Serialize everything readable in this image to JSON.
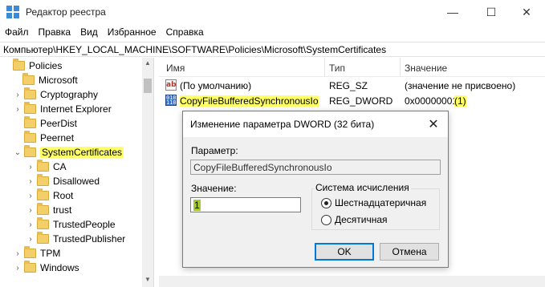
{
  "window": {
    "title": "Редактор реестра",
    "controls": {
      "minimize": "—",
      "maximize": "☐",
      "close": "✕"
    }
  },
  "menu": [
    "Файл",
    "Правка",
    "Вид",
    "Избранное",
    "Справка"
  ],
  "address": "Компьютер\\HKEY_LOCAL_MACHINE\\SOFTWARE\\Policies\\Microsoft\\SystemCertificates",
  "tree": {
    "items": [
      {
        "label": "Policies",
        "toggle": ""
      },
      {
        "label": "Microsoft",
        "toggle": ""
      },
      {
        "label": "Cryptography",
        "toggle": "›"
      },
      {
        "label": "Internet Explorer",
        "toggle": "›"
      },
      {
        "label": "PeerDist",
        "toggle": ""
      },
      {
        "label": "Peernet",
        "toggle": ""
      },
      {
        "label": "SystemCertificates",
        "toggle": "⌄",
        "selected": true
      },
      {
        "label": "CA",
        "toggle": "›"
      },
      {
        "label": "Disallowed",
        "toggle": "›"
      },
      {
        "label": "Root",
        "toggle": "›"
      },
      {
        "label": "trust",
        "toggle": "›"
      },
      {
        "label": "TrustedPeople",
        "toggle": "›"
      },
      {
        "label": "TrustedPublisher",
        "toggle": "›"
      },
      {
        "label": "TPM",
        "toggle": "›"
      },
      {
        "label": "Windows",
        "toggle": "›"
      }
    ]
  },
  "list": {
    "columns": [
      "Имя",
      "Тип",
      "Значение"
    ],
    "rows": [
      {
        "icon": "string-value-icon",
        "name": "(По умолчанию)",
        "type": "REG_SZ",
        "value": "(значение не присвоено)",
        "value_suffix": ""
      },
      {
        "icon": "binary-value-icon",
        "name": "CopyFileBufferedSynchronousIo",
        "type": "REG_DWORD",
        "value": "0x00000001",
        "value_suffix": "(1)"
      }
    ]
  },
  "dialog": {
    "title": "Изменение параметра DWORD (32 бита)",
    "close": "✕",
    "param_label": "Параметр:",
    "param_value": "CopyFileBufferedSynchronousIo",
    "value_label": "Значение:",
    "value": "1",
    "base_group": "Система исчисления",
    "radio_hex": "Шестнадцатеричная",
    "radio_dec": "Десятичная",
    "ok": "OK",
    "cancel": "Отмена"
  },
  "colors": {
    "highlight": "#ffff66",
    "folder": "#f3cf6a",
    "accent": "#0078d7",
    "value_selection": "#a5c635"
  }
}
